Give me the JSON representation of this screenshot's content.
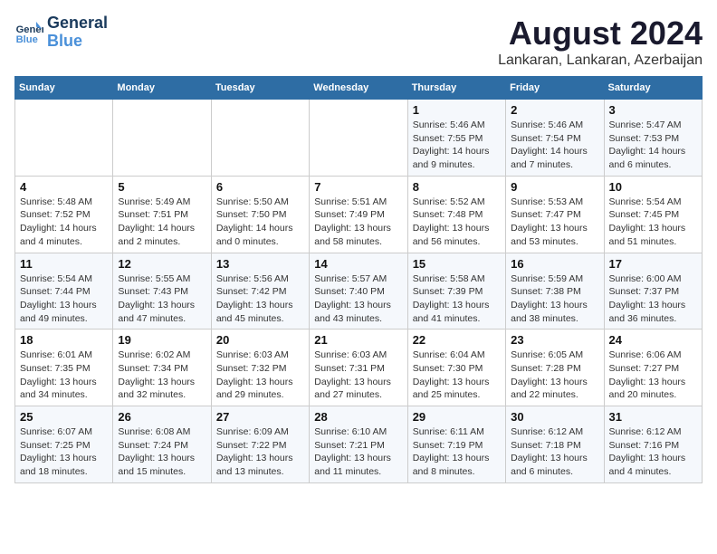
{
  "logo": {
    "line1": "General",
    "line2": "Blue"
  },
  "title": "August 2024",
  "subtitle": "Lankaran, Lankaran, Azerbaijan",
  "days_of_week": [
    "Sunday",
    "Monday",
    "Tuesday",
    "Wednesday",
    "Thursday",
    "Friday",
    "Saturday"
  ],
  "weeks": [
    [
      {
        "day": "",
        "info": ""
      },
      {
        "day": "",
        "info": ""
      },
      {
        "day": "",
        "info": ""
      },
      {
        "day": "",
        "info": ""
      },
      {
        "day": "1",
        "info": "Sunrise: 5:46 AM\nSunset: 7:55 PM\nDaylight: 14 hours\nand 9 minutes."
      },
      {
        "day": "2",
        "info": "Sunrise: 5:46 AM\nSunset: 7:54 PM\nDaylight: 14 hours\nand 7 minutes."
      },
      {
        "day": "3",
        "info": "Sunrise: 5:47 AM\nSunset: 7:53 PM\nDaylight: 14 hours\nand 6 minutes."
      }
    ],
    [
      {
        "day": "4",
        "info": "Sunrise: 5:48 AM\nSunset: 7:52 PM\nDaylight: 14 hours\nand 4 minutes."
      },
      {
        "day": "5",
        "info": "Sunrise: 5:49 AM\nSunset: 7:51 PM\nDaylight: 14 hours\nand 2 minutes."
      },
      {
        "day": "6",
        "info": "Sunrise: 5:50 AM\nSunset: 7:50 PM\nDaylight: 14 hours\nand 0 minutes."
      },
      {
        "day": "7",
        "info": "Sunrise: 5:51 AM\nSunset: 7:49 PM\nDaylight: 13 hours\nand 58 minutes."
      },
      {
        "day": "8",
        "info": "Sunrise: 5:52 AM\nSunset: 7:48 PM\nDaylight: 13 hours\nand 56 minutes."
      },
      {
        "day": "9",
        "info": "Sunrise: 5:53 AM\nSunset: 7:47 PM\nDaylight: 13 hours\nand 53 minutes."
      },
      {
        "day": "10",
        "info": "Sunrise: 5:54 AM\nSunset: 7:45 PM\nDaylight: 13 hours\nand 51 minutes."
      }
    ],
    [
      {
        "day": "11",
        "info": "Sunrise: 5:54 AM\nSunset: 7:44 PM\nDaylight: 13 hours\nand 49 minutes."
      },
      {
        "day": "12",
        "info": "Sunrise: 5:55 AM\nSunset: 7:43 PM\nDaylight: 13 hours\nand 47 minutes."
      },
      {
        "day": "13",
        "info": "Sunrise: 5:56 AM\nSunset: 7:42 PM\nDaylight: 13 hours\nand 45 minutes."
      },
      {
        "day": "14",
        "info": "Sunrise: 5:57 AM\nSunset: 7:40 PM\nDaylight: 13 hours\nand 43 minutes."
      },
      {
        "day": "15",
        "info": "Sunrise: 5:58 AM\nSunset: 7:39 PM\nDaylight: 13 hours\nand 41 minutes."
      },
      {
        "day": "16",
        "info": "Sunrise: 5:59 AM\nSunset: 7:38 PM\nDaylight: 13 hours\nand 38 minutes."
      },
      {
        "day": "17",
        "info": "Sunrise: 6:00 AM\nSunset: 7:37 PM\nDaylight: 13 hours\nand 36 minutes."
      }
    ],
    [
      {
        "day": "18",
        "info": "Sunrise: 6:01 AM\nSunset: 7:35 PM\nDaylight: 13 hours\nand 34 minutes."
      },
      {
        "day": "19",
        "info": "Sunrise: 6:02 AM\nSunset: 7:34 PM\nDaylight: 13 hours\nand 32 minutes."
      },
      {
        "day": "20",
        "info": "Sunrise: 6:03 AM\nSunset: 7:32 PM\nDaylight: 13 hours\nand 29 minutes."
      },
      {
        "day": "21",
        "info": "Sunrise: 6:03 AM\nSunset: 7:31 PM\nDaylight: 13 hours\nand 27 minutes."
      },
      {
        "day": "22",
        "info": "Sunrise: 6:04 AM\nSunset: 7:30 PM\nDaylight: 13 hours\nand 25 minutes."
      },
      {
        "day": "23",
        "info": "Sunrise: 6:05 AM\nSunset: 7:28 PM\nDaylight: 13 hours\nand 22 minutes."
      },
      {
        "day": "24",
        "info": "Sunrise: 6:06 AM\nSunset: 7:27 PM\nDaylight: 13 hours\nand 20 minutes."
      }
    ],
    [
      {
        "day": "25",
        "info": "Sunrise: 6:07 AM\nSunset: 7:25 PM\nDaylight: 13 hours\nand 18 minutes."
      },
      {
        "day": "26",
        "info": "Sunrise: 6:08 AM\nSunset: 7:24 PM\nDaylight: 13 hours\nand 15 minutes."
      },
      {
        "day": "27",
        "info": "Sunrise: 6:09 AM\nSunset: 7:22 PM\nDaylight: 13 hours\nand 13 minutes."
      },
      {
        "day": "28",
        "info": "Sunrise: 6:10 AM\nSunset: 7:21 PM\nDaylight: 13 hours\nand 11 minutes."
      },
      {
        "day": "29",
        "info": "Sunrise: 6:11 AM\nSunset: 7:19 PM\nDaylight: 13 hours\nand 8 minutes."
      },
      {
        "day": "30",
        "info": "Sunrise: 6:12 AM\nSunset: 7:18 PM\nDaylight: 13 hours\nand 6 minutes."
      },
      {
        "day": "31",
        "info": "Sunrise: 6:12 AM\nSunset: 7:16 PM\nDaylight: 13 hours\nand 4 minutes."
      }
    ]
  ]
}
